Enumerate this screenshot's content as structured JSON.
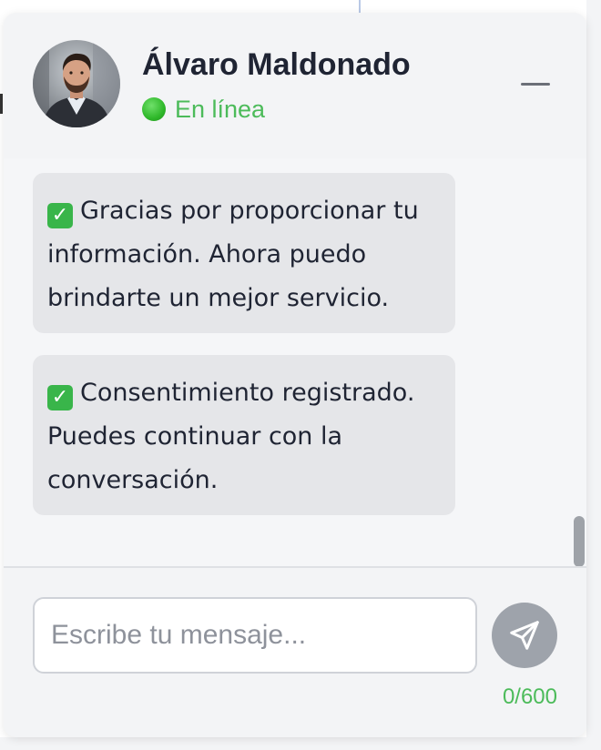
{
  "header": {
    "agent_name": "Álvaro Maldonado",
    "status": "En línea",
    "avatar_icon": "person-portrait-icon",
    "minimize_icon": "minimize-icon"
  },
  "messages": [
    {
      "icon": "check-mark-icon",
      "text": "Gracias por proporcionar tu información. Ahora puedo brindarte un mejor servicio."
    },
    {
      "icon": "check-mark-icon",
      "text": "Consentimiento registrado. Puedes continuar con la conversación."
    }
  ],
  "composer": {
    "placeholder": "Escribe tu mensaje...",
    "value": "",
    "send_icon": "send-paper-plane-icon",
    "char_counter": "0/600"
  },
  "colors": {
    "status_green": "#4cbb5a",
    "bubble_bg": "#e5e6e9",
    "panel_bg": "#f3f4f6",
    "send_button": "#9ea3ab"
  }
}
